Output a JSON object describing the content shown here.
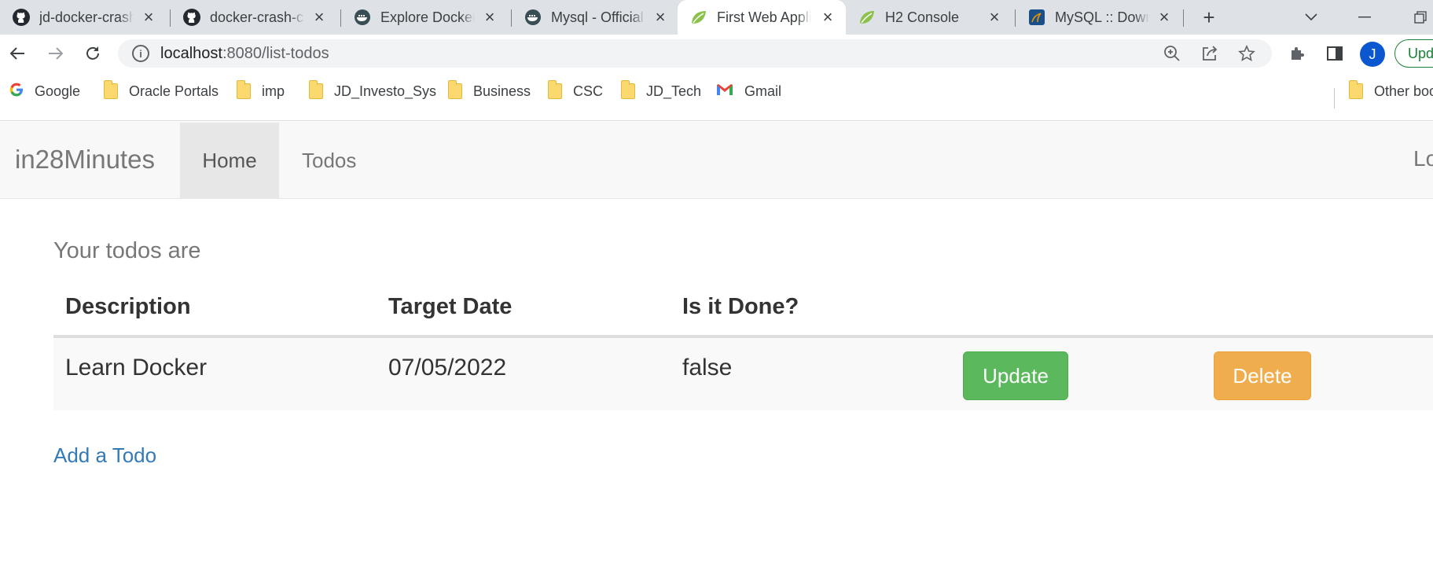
{
  "browser": {
    "tabs": [
      {
        "title": "jd-docker-crash-course",
        "favicon": "github-icon",
        "active": false
      },
      {
        "title": "docker-crash-course",
        "favicon": "github-icon",
        "active": false
      },
      {
        "title": "Explore Docker",
        "favicon": "docker-icon",
        "active": false
      },
      {
        "title": "Mysql - Official",
        "favicon": "docker-icon",
        "active": false
      },
      {
        "title": "First Web Application",
        "favicon": "spring-icon",
        "active": true
      },
      {
        "title": "H2 Console",
        "favicon": "spring-icon",
        "active": false
      },
      {
        "title": "MySQL :: Download",
        "favicon": "mysql-icon",
        "active": false
      }
    ],
    "address": {
      "host": "localhost",
      "path": ":8080/list-todos"
    },
    "profile_initial": "J",
    "update_label": "Update",
    "bookmarks": [
      {
        "label": "Google",
        "icon": "google-icon"
      },
      {
        "label": "Oracle Portals",
        "icon": "folder-icon"
      },
      {
        "label": "imp",
        "icon": "folder-icon"
      },
      {
        "label": "JD_Investo_Sys",
        "icon": "folder-icon"
      },
      {
        "label": "Business",
        "icon": "folder-icon"
      },
      {
        "label": "CSC",
        "icon": "folder-icon"
      },
      {
        "label": "JD_Tech",
        "icon": "folder-icon"
      },
      {
        "label": "Gmail",
        "icon": "gmail-icon"
      }
    ],
    "other_bookmarks": "Other bookmarks"
  },
  "page": {
    "brand": "in28Minutes",
    "nav": [
      {
        "label": "Home",
        "active": true
      },
      {
        "label": "Todos",
        "active": false
      }
    ],
    "nav_right": "Logout",
    "lead": "Your todos are",
    "table": {
      "headers": [
        "Description",
        "Target Date",
        "Is it Done?"
      ],
      "rows": [
        {
          "description": "Learn Docker",
          "target_date": "07/05/2022",
          "done": "false",
          "update_label": "Update",
          "delete_label": "Delete"
        }
      ]
    },
    "add_link": "Add a Todo"
  },
  "colors": {
    "success": "#5cb85c",
    "warning": "#f0ad4e",
    "link": "#337ab7",
    "navbar_bg": "#f8f8f8"
  }
}
